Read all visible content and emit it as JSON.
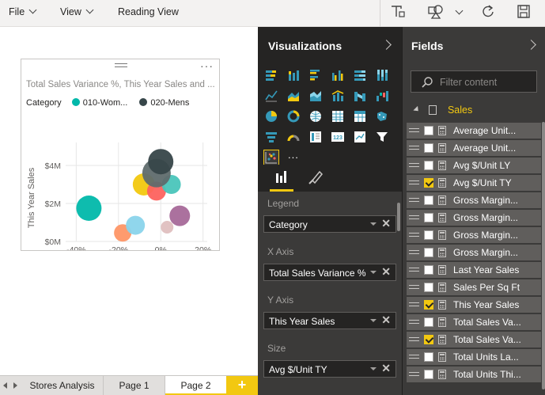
{
  "toolbar": {
    "menus": [
      {
        "label": "File"
      },
      {
        "label": "View"
      },
      {
        "label": "Reading View"
      }
    ]
  },
  "visual": {
    "title": "Total Sales Variance %, This Year Sales and ...",
    "legend_label": "Category",
    "legend_items": [
      {
        "label": "010-Wom...",
        "color": "#01b8aa"
      },
      {
        "label": "020-Mens",
        "color": "#374649"
      }
    ]
  },
  "chart_data": {
    "type": "scatter",
    "title": "Total Sales Variance %, This Year Sales and ...",
    "xlabel": "Total Sales Variance %",
    "ylabel": "This Year Sales",
    "x_ticks": [
      "-40%",
      "-20%",
      "0%",
      "20%"
    ],
    "y_ticks": [
      "$0M",
      "$2M",
      "$4M"
    ],
    "xlim": [
      -45,
      22
    ],
    "ylim": [
      0,
      5
    ],
    "legend": "top",
    "points": [
      {
        "x": -34,
        "y": 1.75,
        "size": 16,
        "color": "#01b8aa"
      },
      {
        "x": -18,
        "y": 0.45,
        "size": 11,
        "color": "#fe9666"
      },
      {
        "x": -12,
        "y": 0.85,
        "size": 12,
        "color": "#8ad4eb"
      },
      {
        "x": -8,
        "y": 3.0,
        "size": 14,
        "color": "#f2c80f"
      },
      {
        "x": -2,
        "y": 2.65,
        "size": 12,
        "color": "#fd625e"
      },
      {
        "x": 3,
        "y": 0.75,
        "size": 8,
        "color": "#dfbfbf"
      },
      {
        "x": 5,
        "y": 3.0,
        "size": 12,
        "color": "#4ac5bb"
      },
      {
        "x": 9,
        "y": 1.35,
        "size": 13,
        "color": "#a66999"
      },
      {
        "x": -2,
        "y": 3.6,
        "size": 18,
        "color": "#5f6b6d"
      },
      {
        "x": 0,
        "y": 4.2,
        "size": 16,
        "color": "#374649"
      }
    ]
  },
  "tabs": [
    {
      "label": "Stores Analysis"
    },
    {
      "label": "Page 1"
    },
    {
      "label": "Page 2"
    }
  ],
  "visualizations": {
    "title": "Visualizations",
    "wells": [
      {
        "label": "Legend",
        "value": "Category"
      },
      {
        "label": "X Axis",
        "value": "Total Sales Variance %"
      },
      {
        "label": "Y Axis",
        "value": "This Year Sales"
      },
      {
        "label": "Size",
        "value": "Avg $/Unit TY"
      }
    ],
    "more_label": "..."
  },
  "fields": {
    "title": "Fields",
    "search_placeholder": "Filter content",
    "table_name": "Sales",
    "items": [
      {
        "label": "Average Unit...",
        "checked": false
      },
      {
        "label": "Average Unit...",
        "checked": false
      },
      {
        "label": "Avg $/Unit LY",
        "checked": false
      },
      {
        "label": "Avg $/Unit TY",
        "checked": true
      },
      {
        "label": "Gross Margin...",
        "checked": false
      },
      {
        "label": "Gross Margin...",
        "checked": false
      },
      {
        "label": "Gross Margin...",
        "checked": false
      },
      {
        "label": "Gross Margin...",
        "checked": false
      },
      {
        "label": "Last Year Sales",
        "checked": false
      },
      {
        "label": "Sales Per Sq Ft",
        "checked": false
      },
      {
        "label": "This Year Sales",
        "checked": true
      },
      {
        "label": "Total Sales Va...",
        "checked": false
      },
      {
        "label": "Total Sales Va...",
        "checked": true
      },
      {
        "label": "Total Units La...",
        "checked": false
      },
      {
        "label": "Total Units Thi...",
        "checked": false
      }
    ]
  }
}
